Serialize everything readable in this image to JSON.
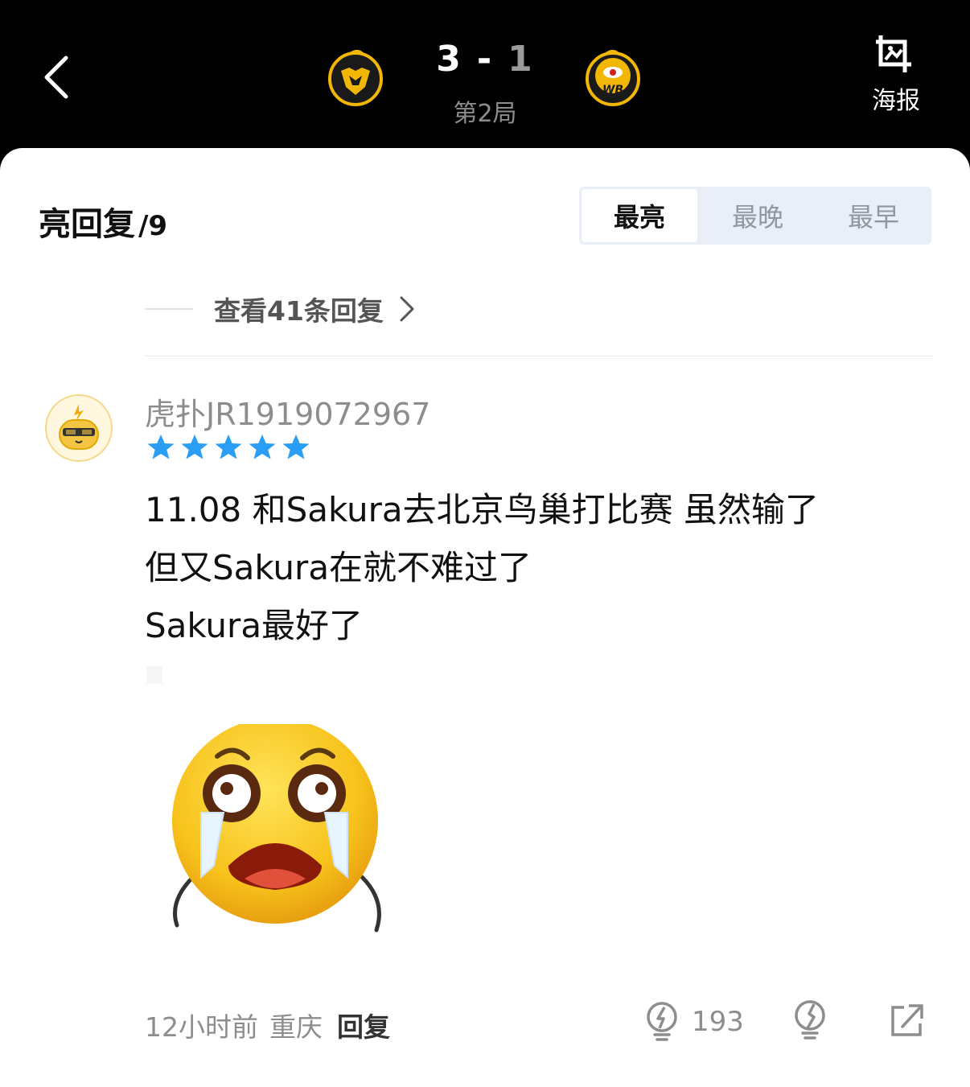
{
  "header": {
    "score_home": "3",
    "score_sep": "-",
    "score_away": "1",
    "round": "第2局",
    "poster_label": "海报",
    "home_logo_icon": "wolf-team-logo",
    "away_logo_icon": "wb-team-logo"
  },
  "section": {
    "title": "亮回复",
    "count": "/9"
  },
  "sort_tabs": [
    {
      "label": "最亮",
      "active": true
    },
    {
      "label": "最晚",
      "active": false
    },
    {
      "label": "最早",
      "active": false
    }
  ],
  "view_replies": "查看41条回复",
  "comment": {
    "username": "虎扑JR1919072967",
    "stars": 5,
    "lines": [
      "11.08 和Sakura去北京鸟巢打比赛 虽然输了",
      "但又Sakura在就不难过了",
      "Sakura最好了"
    ],
    "sticker_icon": "crying-face-emoji",
    "time": "12小时前",
    "location": "重庆",
    "reply_label": "回复",
    "light_count": "193"
  },
  "colors": {
    "header_bg": "#000000",
    "star": "#2a9df4",
    "tab_bg": "#e9eef7",
    "logo_gold": "#f2b705"
  }
}
